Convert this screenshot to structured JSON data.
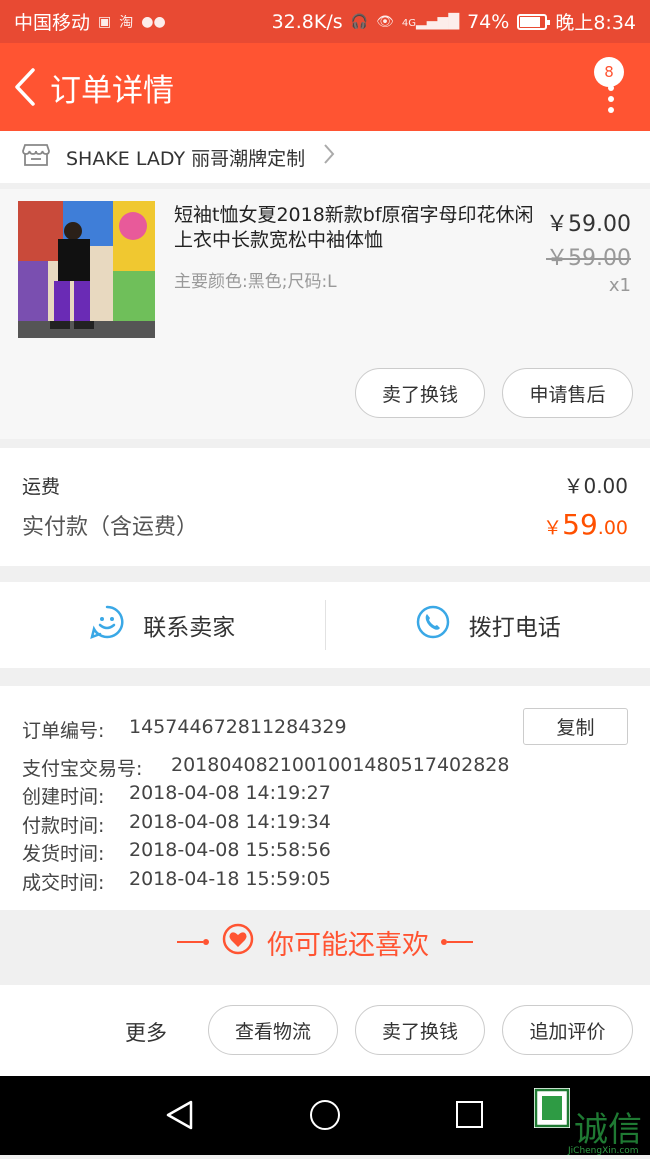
{
  "status_bar": {
    "carrier": "中国移动",
    "network_speed": "32.8K/s",
    "battery": "74%",
    "time": "晚上8:34",
    "net_type": "4G"
  },
  "header": {
    "title": "订单详情",
    "badge_count": "8"
  },
  "shop": {
    "name": "SHAKE LADY 丽哥潮牌定制"
  },
  "product": {
    "title": "短袖t恤女夏2018新款bf原宿字母印花休闲上衣中长款宽松中袖体恤",
    "sku": "主要颜色:黑色;尺码:L",
    "price": "￥59.00",
    "original_price": "￥59.00",
    "quantity": "x1",
    "buttons": {
      "resell": "卖了换钱",
      "after_sale": "申请售后"
    }
  },
  "summary": {
    "freight_label": "运费",
    "freight_value": "￥0.00",
    "paid_label": "实付款（含运费）",
    "paid_yen": "￥",
    "paid_int": "59",
    "paid_dec": ".00"
  },
  "contact": {
    "seller": "联系卖家",
    "phone": "拨打电话"
  },
  "order_info": {
    "copy_button": "复制",
    "rows": [
      {
        "label": "订单编号:",
        "value": "145744672811284329"
      },
      {
        "label": "支付宝交易号:",
        "value": "2018040821001001480517402828"
      },
      {
        "label": "创建时间:",
        "value": "2018-04-08 14:19:27"
      },
      {
        "label": "付款时间:",
        "value": "2018-04-08 14:19:34"
      },
      {
        "label": "发货时间:",
        "value": "2018-04-08 15:58:56"
      },
      {
        "label": "成交时间:",
        "value": "2018-04-18 15:59:05"
      }
    ]
  },
  "recommend": {
    "title": "你可能还喜欢"
  },
  "actions": {
    "more": "更多",
    "logistics": "查看物流",
    "resell": "卖了换钱",
    "add_review": "追加评价"
  },
  "watermark": {
    "text": "诚信",
    "sub": "JiChengXin.com"
  },
  "colors": {
    "header": "#ff5432",
    "status_bar": "#e84a33",
    "price_accent": "#ff5000",
    "contact_icon": "#3aa8e6"
  },
  "icons": {
    "back": "chevron-left-icon",
    "menu": "vertical-dots-icon",
    "shop": "store-icon",
    "chat": "smiley-chat-icon",
    "phone": "phone-icon",
    "heart": "heart-circle-icon"
  }
}
